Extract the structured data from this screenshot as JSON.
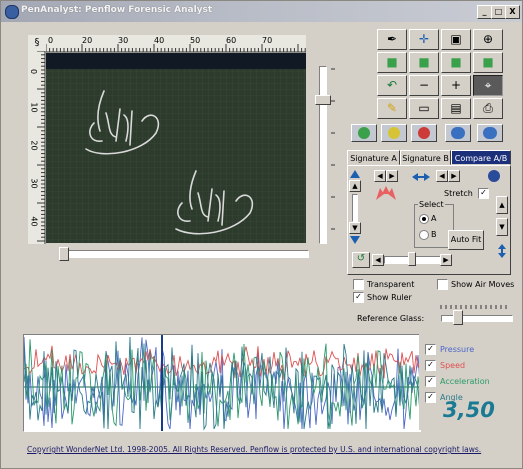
{
  "window": {
    "title": "PenAnalyst: Penflow Forensic Analyst",
    "controls": [
      "_",
      "□",
      "X"
    ]
  },
  "rulers": {
    "top_ticks": [
      "0",
      "20",
      "30",
      "40",
      "50",
      "60",
      "70"
    ],
    "left_ticks": [
      "0",
      "10",
      "20",
      "30",
      "40"
    ],
    "corner_icon": "ruler-corner-icon"
  },
  "canvas": {
    "background": "#2d3b2c",
    "ink": "#d9d9d9"
  },
  "toolbar": {
    "tools": [
      {
        "icon": "pen-tool-icon",
        "glyph": "✒"
      },
      {
        "icon": "move-icon",
        "glyph": "✛"
      },
      {
        "icon": "crop-icon",
        "glyph": "▣"
      },
      {
        "icon": "rotate-icon",
        "glyph": "⊕"
      },
      {
        "icon": "cube-green-icon",
        "glyph": "■"
      },
      {
        "icon": "cube-green-2-icon",
        "glyph": "■"
      },
      {
        "icon": "cube-green-3-icon",
        "glyph": "■"
      },
      {
        "icon": "cube-green-4-icon",
        "glyph": "■"
      },
      {
        "icon": "undo-icon",
        "glyph": "↶"
      },
      {
        "icon": "zoom-out-icon",
        "glyph": "−"
      },
      {
        "icon": "zoom-in-icon",
        "glyph": "+"
      },
      {
        "icon": "inspect-icon",
        "glyph": "⌖"
      },
      {
        "icon": "highlight-icon",
        "glyph": "✎"
      },
      {
        "icon": "open-folder-icon",
        "glyph": "▭"
      },
      {
        "icon": "save-icon",
        "glyph": "▤"
      },
      {
        "icon": "print-icon",
        "glyph": "⎙"
      }
    ]
  },
  "playback": {
    "buttons": [
      "play-icon",
      "pause-icon",
      "record-icon",
      "rewind-icon",
      "forward-icon"
    ]
  },
  "tabs": [
    {
      "label": "Signature A",
      "active": false
    },
    {
      "label": "Signature B",
      "active": false
    },
    {
      "label": "Compare A/B",
      "active": true
    }
  ],
  "compare_panel": {
    "stretch_label": "Stretch",
    "stretch_checked": true,
    "select_label": "Select",
    "option_a": "A",
    "option_b": "B",
    "selected": "A",
    "autofit_label": "Auto Fit"
  },
  "options": {
    "transparent_label": "Transparent",
    "transparent_checked": false,
    "show_air_moves_label": "Show Air Moves",
    "show_air_moves_checked": false,
    "show_ruler_label": "Show Ruler",
    "show_ruler_checked": true,
    "reference_glass_label": "Reference Glass:"
  },
  "graph": {
    "legend": [
      {
        "label": "Pressure",
        "color": "#4a66c8",
        "checked": true
      },
      {
        "label": "Speed",
        "color": "#e05050",
        "checked": true
      },
      {
        "label": "Acceleration",
        "color": "#2a9a6a",
        "checked": true
      },
      {
        "label": "Angle",
        "color": "#2a7a8a",
        "checked": true
      }
    ],
    "value": "3,50"
  },
  "footer": {
    "copyright": "Copyright WonderNet Ltd. 1998-2005. All Rights Reserved. Penflow is protected by U.S. and international copyright laws."
  }
}
